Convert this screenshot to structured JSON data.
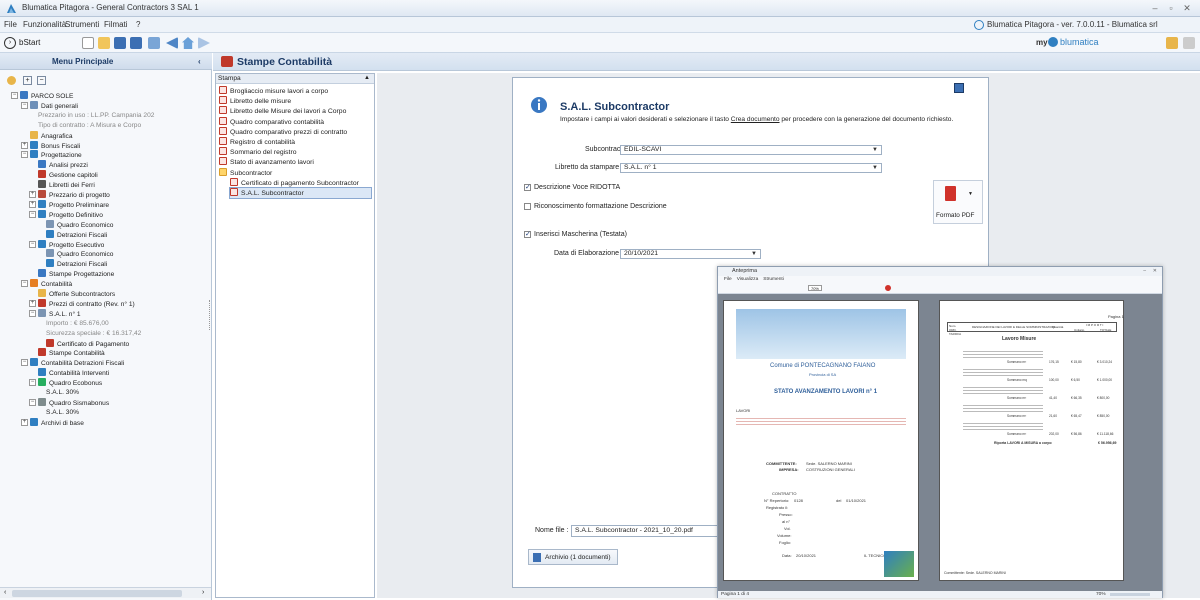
{
  "window": {
    "title": "Blumatica Pitagora - General Contractors 3 SAL 1"
  },
  "menu": [
    "File",
    "Funzionalità",
    "Strumenti",
    "Filmati",
    "?"
  ],
  "menu_right": "Blumatica Pitagora - ver. 7.0.0.11 - Blumatica srl",
  "toolbar": {
    "start_label": "bStart",
    "myblumatica": "my",
    "brand": "blumatica"
  },
  "left_panel": {
    "header": "Menu Principale",
    "tree": [
      {
        "label": "PARCO SOLE",
        "grey": false
      },
      {
        "label": "Dati generali",
        "grey": false
      },
      {
        "label": "Prezzario in uso : LL.PP. Campania 202",
        "grey": true
      },
      {
        "label": "Tipo di contratto : A Misura e Corpo",
        "grey": true
      },
      {
        "label": "Anagrafica",
        "grey": false
      },
      {
        "label": "Bonus Fiscali",
        "grey": false
      },
      {
        "label": "Progettazione",
        "grey": false
      },
      {
        "label": "Analisi prezzi",
        "grey": false
      },
      {
        "label": "Gestione capitoli",
        "grey": false
      },
      {
        "label": "Libretti dei Ferri",
        "grey": false
      },
      {
        "label": "Prezzario di progetto",
        "grey": false
      },
      {
        "label": "Progetto Preliminare",
        "grey": false
      },
      {
        "label": "Progetto Definitivo",
        "grey": false
      },
      {
        "label": "Quadro Economico",
        "grey": false
      },
      {
        "label": "Detrazioni Fiscali",
        "grey": false
      },
      {
        "label": "Progetto Esecutivo",
        "grey": false
      },
      {
        "label": "Quadro Economico",
        "grey": false
      },
      {
        "label": "Detrazioni Fiscali",
        "grey": false
      },
      {
        "label": "Stampe Progettazione",
        "grey": false
      },
      {
        "label": "Contabilità",
        "grey": false
      },
      {
        "label": "Offerte Subcontractors",
        "grey": false
      },
      {
        "label": "Prezzi di contratto (Rev. n° 1)",
        "grey": false
      },
      {
        "label": "S.A.L. n° 1",
        "grey": false
      },
      {
        "label": "Importo : € 85.676,00",
        "grey": true
      },
      {
        "label": "Sicurezza speciale : € 16.317,42",
        "grey": true
      },
      {
        "label": "Certificato di Pagamento",
        "grey": false
      },
      {
        "label": "Stampe Contabilità",
        "grey": false
      },
      {
        "label": "Contabilità Detrazioni Fiscali",
        "grey": false
      },
      {
        "label": "Contabilità Interventi",
        "grey": false
      },
      {
        "label": "Quadro Ecobonus",
        "grey": false
      },
      {
        "label": "S.A.L. 30%",
        "grey": false
      },
      {
        "label": "Quadro Sismabonus",
        "grey": false
      },
      {
        "label": "S.A.L. 30%",
        "grey": false
      },
      {
        "label": "Archivi di base",
        "grey": false
      }
    ]
  },
  "center": {
    "title": "Stampe Contabilità",
    "list_header": "Stampa",
    "list": [
      "Brogliaccio misure lavori a corpo",
      "Libretto delle misure",
      "Libretto delle Misure dei lavori a Corpo",
      "Quadro comparativo contabilità",
      "Quadro comparativo prezzi di contratto",
      "Registro di contabilità",
      "Sommario del registro",
      "Stato di avanzamento lavori",
      "Subcontractor",
      "Certificato di pagamento Subcontractor",
      "S.A.L. Subcontractor"
    ]
  },
  "form": {
    "title": "S.A.L. Subcontractor",
    "description_pre": "Impostare i campi ai valori desiderati e selezionare il tasto ",
    "description_link": "Crea documento",
    "description_post": " per procedere con la generazione del documento richiesto.",
    "subcontractor_label": "Subcontractor",
    "subcontractor_value": "EDIL-SCAVI",
    "libretto_label": "Libretto da stampare",
    "libretto_value": "S.A.L. n° 1",
    "chk_descrizione": "Descrizione Voce RIDOTTA",
    "chk_riconoscimento": "Riconoscimento formattazione Descrizione",
    "chk_mascherina": "Inserisci Mascherina (Testata)",
    "data_label": "Data di Elaborazione",
    "data_value": "20/10/2021",
    "format_label": "Formato PDF",
    "nome_file_label": "Nome file :",
    "nome_file_value": "S.A.L. Subcontractor - 2021_10_20.pdf",
    "archivio_label": "Archivio (1 documenti)"
  },
  "preview": {
    "title": "Anteprima",
    "menu": [
      "File",
      "Visualizza",
      "Strumenti"
    ],
    "zoom": "70%",
    "page1": {
      "comune": "Comune di PONTECAGNANO FAIANO",
      "provincia": "Provincia di SA",
      "heading": "STATO AVANZAMENTO LAVORI n° 1",
      "lavori": "LAVORI",
      "committente_label": "COMMITTENTE:",
      "committente": "Sede. SALERNO MARINI",
      "impresa_label": "IMPRESA:",
      "impresa": "COSTRUZIONI GENERALI",
      "contratto": "CONTRATTO",
      "rep_label": "N° Repertorio:",
      "rep": "0128",
      "del": "del",
      "rep_date": "01/10/2021",
      "registrato": "Registrato il:",
      "presso": "Presso:",
      "al_n": "al n°",
      "vol": "Vol.",
      "volume": "Volume:",
      "foglio": "Foglio:",
      "data_label": "Data:",
      "data": "20/10/2021",
      "tecnico": "IL TECNICO"
    },
    "page2": {
      "header": "Pagina 1",
      "col_num": "Num. ORD. TARIFFA",
      "col_desc": "DESIGNAZIONE DEI LAVORI E DELLE SOMMINISTRAZIONI",
      "col_qty": "Quantità",
      "col_imp": "I M P O R T I",
      "col_unit": "Unitario",
      "col_tot": "TOTALE",
      "section": "Lavoro Misure",
      "rows": [
        {
          "label": "Sommano m³",
          "qty": "176,15",
          "unit": "€ 15,80",
          "tot": "€ 3.010,24"
        },
        {
          "label": "Sommano mq",
          "qty": "100,00",
          "unit": "€ 6,50",
          "tot": "€ 1.000,00"
        },
        {
          "label": "Sommano m³",
          "qty": "41,40",
          "unit": "€ 66,35",
          "tot": "€ 800,00"
        },
        {
          "label": "Sommano m³",
          "qty": "21,60",
          "unit": "€ 65,47",
          "tot": "€ 850,00"
        },
        {
          "label": "Sommano m³",
          "qty": "202,00",
          "unit": "€ 56,86",
          "tot": "€ 11.118,66"
        }
      ],
      "riporto": "Riporta LAVORI A MISURA a corpo",
      "riporto_val": "€ 56.956,69",
      "footer": "Committente: Sede. SALERNO MARINI"
    },
    "status": "Pagina 1 di 4",
    "zoom_status": "70%"
  },
  "colors": {
    "accent": "#1d3b66",
    "header_bg": "#d3e0ef",
    "selection": "#dbe7f6",
    "pdf_red": "#d0322b",
    "brand_blue": "#2f7fc1"
  }
}
